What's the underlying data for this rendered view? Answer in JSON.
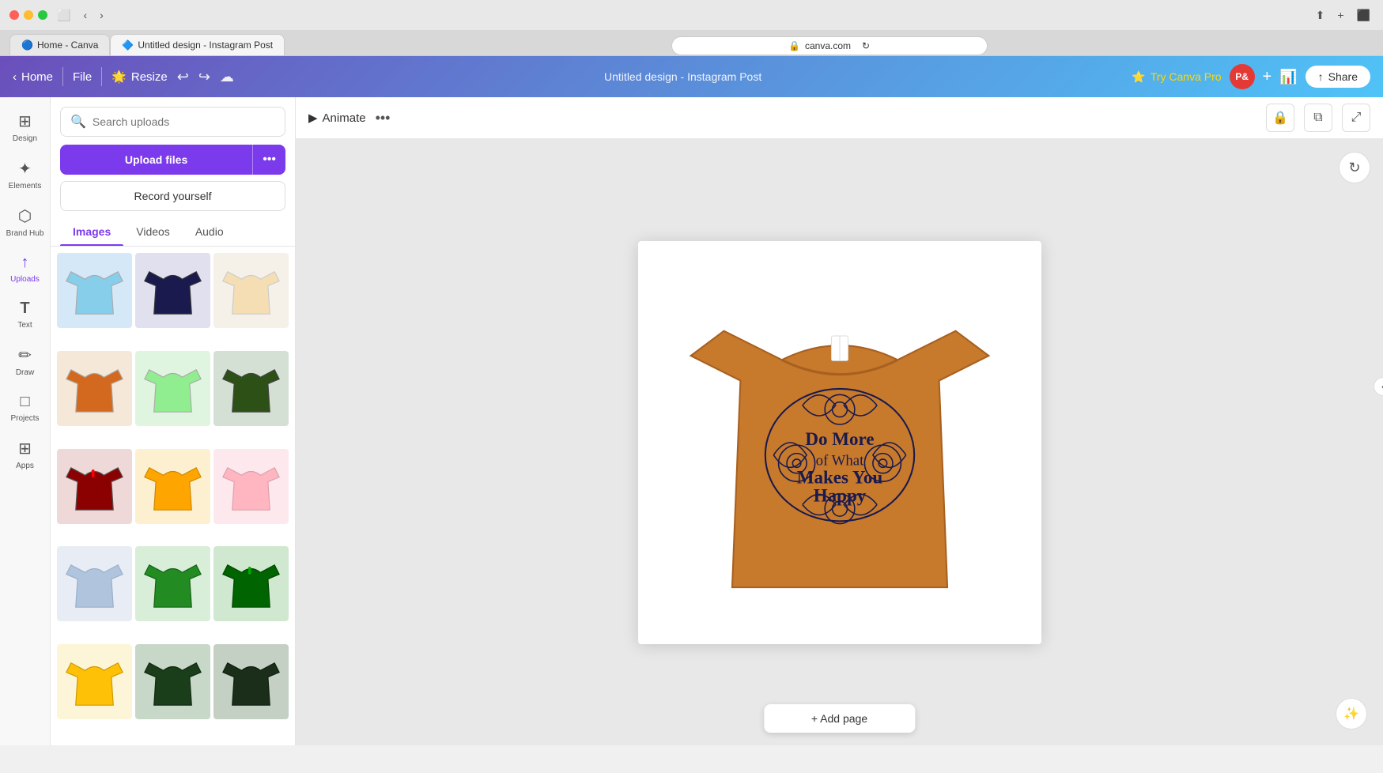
{
  "browser": {
    "traffic_lights": [
      "red",
      "yellow",
      "green"
    ],
    "tabs": [
      {
        "label": "Home - Canva",
        "favicon": "🔵",
        "active": false
      },
      {
        "label": "Untitled design - Instagram Post",
        "favicon": "🔷",
        "active": true
      }
    ],
    "address": "canva.com"
  },
  "toolbar": {
    "home_label": "Home",
    "file_label": "File",
    "resize_label": "Resize",
    "title": "Untitled design - Instagram Post",
    "try_pro_label": "Try Canva Pro",
    "avatar_label": "P&",
    "share_label": "Share"
  },
  "sidebar_icons": [
    {
      "name": "design",
      "label": "Design",
      "icon": "⊞"
    },
    {
      "name": "elements",
      "label": "Elements",
      "icon": "✦"
    },
    {
      "name": "brand-hub",
      "label": "Brand Hub",
      "icon": "⬡"
    },
    {
      "name": "uploads",
      "label": "Uploads",
      "icon": "↑",
      "active": true
    },
    {
      "name": "text",
      "label": "Text",
      "icon": "T"
    },
    {
      "name": "draw",
      "label": "Draw",
      "icon": "✏"
    },
    {
      "name": "projects",
      "label": "Projects",
      "icon": "□"
    },
    {
      "name": "apps",
      "label": "Apps",
      "icon": "⊞"
    }
  ],
  "uploads_panel": {
    "search_placeholder": "Search uploads",
    "upload_files_label": "Upload files",
    "upload_more_icon": "•••",
    "record_yourself_label": "Record yourself",
    "tabs": [
      {
        "label": "Images",
        "active": true
      },
      {
        "label": "Videos",
        "active": false
      },
      {
        "label": "Audio",
        "active": false
      }
    ]
  },
  "tshirts": [
    {
      "color": "#87CEEB",
      "id": "light-blue"
    },
    {
      "color": "#1a1a4e",
      "id": "dark-navy"
    },
    {
      "color": "#f5deb3",
      "id": "beige"
    },
    {
      "color": "#d2691e",
      "id": "orange-brown"
    },
    {
      "color": "#90EE90",
      "id": "mint-green"
    },
    {
      "color": "#2d5016",
      "id": "dark-green"
    },
    {
      "color": "#8b0000",
      "id": "dark-red"
    },
    {
      "color": "#ffa500",
      "id": "orange-yellow"
    },
    {
      "color": "#ffb6c1",
      "id": "light-pink"
    },
    {
      "color": "#b0c4de",
      "id": "light-steel-blue"
    },
    {
      "color": "#228B22",
      "id": "forest-green"
    },
    {
      "color": "#006400",
      "id": "dark-green-2"
    },
    {
      "color": "#ffa500",
      "id": "golden"
    },
    {
      "color": "#1a3d1a",
      "id": "very-dark-green"
    },
    {
      "color": "#1a2e1a",
      "id": "dark-forest"
    }
  ],
  "canvas": {
    "animate_label": "Animate",
    "add_page_label": "+ Add page",
    "design_title": "Do More of What Makes You Happy"
  }
}
